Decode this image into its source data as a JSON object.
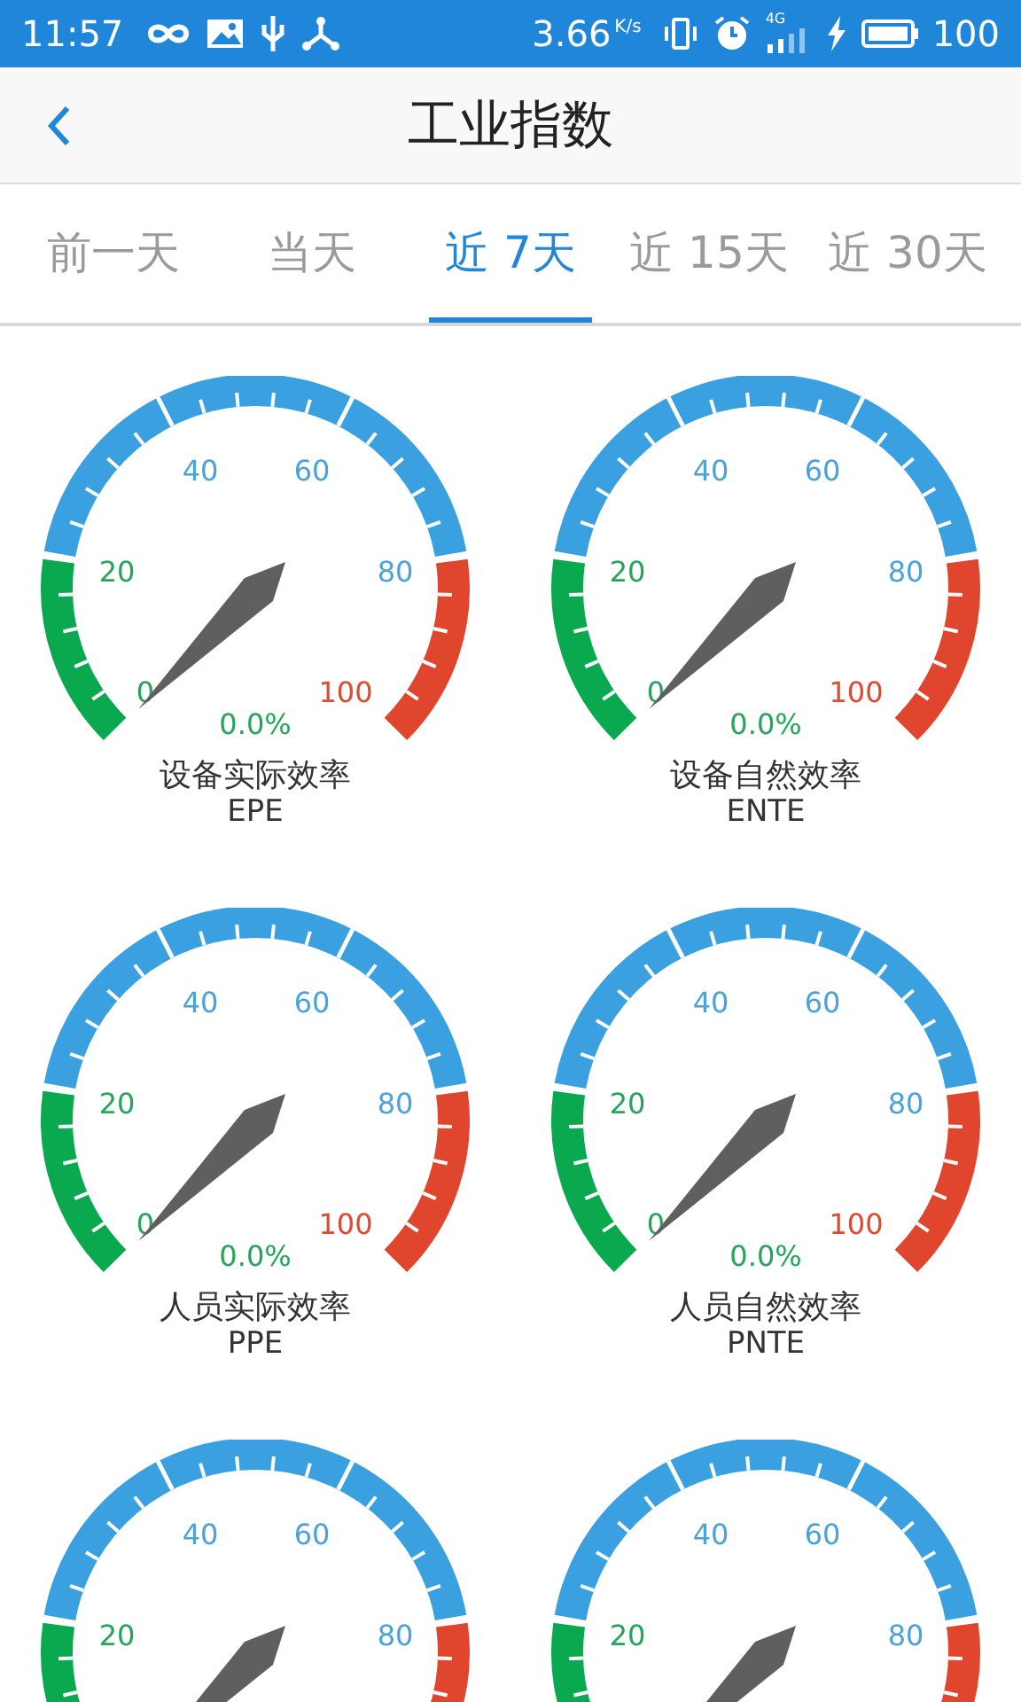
{
  "status_bar": {
    "time": "11:57",
    "speed": "3.66",
    "speed_unit": "K/s",
    "network": "4G",
    "battery": "100"
  },
  "header": {
    "title": "工业指数"
  },
  "tabs": [
    {
      "label": "前一天",
      "selected": false
    },
    {
      "label": "当天",
      "selected": false
    },
    {
      "label": "近 7天",
      "selected": true
    },
    {
      "label": "近 15天",
      "selected": false
    },
    {
      "label": "近 30天",
      "selected": false
    }
  ],
  "gauges": [
    {
      "scale_labels": [
        {
          "text": "0",
          "kind": "p0"
        },
        {
          "text": "20",
          "kind": "p20"
        },
        {
          "text": "40",
          "kind": "p40"
        },
        {
          "text": "60",
          "kind": "p60"
        },
        {
          "text": "80",
          "kind": "p80"
        },
        {
          "text": "100",
          "kind": "p100"
        }
      ],
      "value": "0.0%",
      "name": "设备实际效率",
      "code": "EPE"
    },
    {
      "scale_labels": [
        {
          "text": "0",
          "kind": "p0"
        },
        {
          "text": "20",
          "kind": "p20"
        },
        {
          "text": "40",
          "kind": "p40"
        },
        {
          "text": "60",
          "kind": "p60"
        },
        {
          "text": "80",
          "kind": "p80"
        },
        {
          "text": "100",
          "kind": "p100"
        }
      ],
      "value": "0.0%",
      "name": "设备自然效率",
      "code": "ENTE"
    },
    {
      "scale_labels": [
        {
          "text": "0",
          "kind": "p0"
        },
        {
          "text": "20",
          "kind": "p20"
        },
        {
          "text": "40",
          "kind": "p40"
        },
        {
          "text": "60",
          "kind": "p60"
        },
        {
          "text": "80",
          "kind": "p80"
        },
        {
          "text": "100",
          "kind": "p100"
        }
      ],
      "value": "0.0%",
      "name": "人员实际效率",
      "code": "PPE"
    },
    {
      "scale_labels": [
        {
          "text": "0",
          "kind": "p0"
        },
        {
          "text": "20",
          "kind": "p20"
        },
        {
          "text": "40",
          "kind": "p40"
        },
        {
          "text": "60",
          "kind": "p60"
        },
        {
          "text": "80",
          "kind": "p80"
        },
        {
          "text": "100",
          "kind": "p100"
        }
      ],
      "value": "0.0%",
      "name": "人员自然效率",
      "code": "PNTE"
    },
    {
      "scale_labels": [
        {
          "text": "20",
          "kind": "p20"
        },
        {
          "text": "40",
          "kind": "p40"
        },
        {
          "text": "60",
          "kind": "p60"
        },
        {
          "text": "80",
          "kind": "p80"
        }
      ]
    },
    {
      "scale_labels": [
        {
          "text": "20",
          "kind": "p20"
        },
        {
          "text": "40",
          "kind": "p40"
        },
        {
          "text": "60",
          "kind": "p60"
        },
        {
          "text": "80",
          "kind": "p80"
        }
      ]
    }
  ]
}
